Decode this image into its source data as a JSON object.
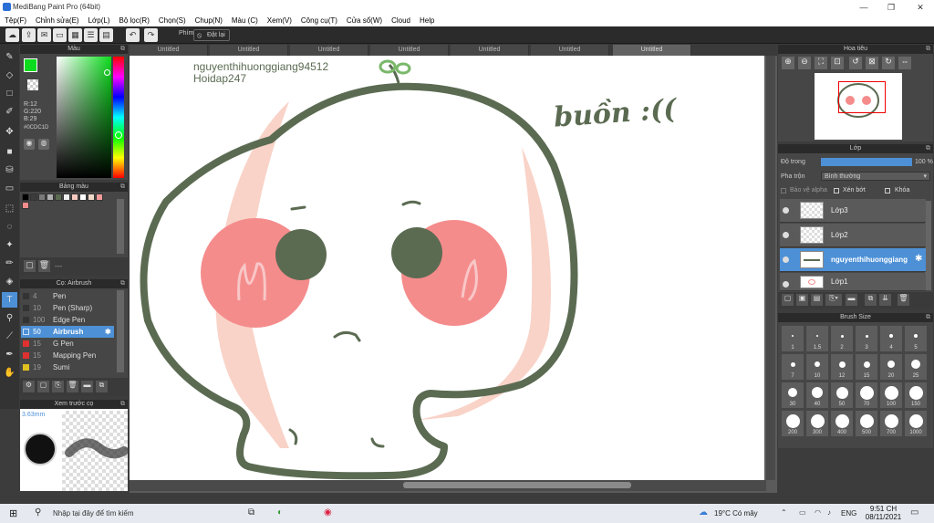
{
  "app": {
    "title": "MediBang Paint Pro (64bit)"
  },
  "menu": [
    "Tệp(F)",
    "Chỉnh sửa(E)",
    "Lớp(L)",
    "Bộ lọc(R)",
    "Chọn(S)",
    "Chụp(N)",
    "Màu (C)",
    "Xem(V)",
    "Công cụ(T)",
    "Cửa sổ(W)",
    "Cloud",
    "Help"
  ],
  "toolbar": {
    "keys_label": "Phím",
    "reset_label": "Đặt lại"
  },
  "tabs": [
    "Untitled",
    "Untitled",
    "Untitled",
    "Untitled",
    "Untitled",
    "Untitled",
    "Untitled"
  ],
  "color_panel": {
    "title": "Màu",
    "r": "R:12",
    "g": "G:220",
    "b": "B:29",
    "hex": "#0CDC1D",
    "fg_color": "#0CDC1D"
  },
  "palette_panel": {
    "title": "Bảng màu",
    "footer": "---",
    "swatches": [
      "#000000",
      "#3c3c3c",
      "#7a7a7a",
      "#b0b0b0",
      "#5b6b52",
      "#f0f0f0",
      "#f4c9c0",
      "#ffffff",
      "#efd8c8",
      "#f39a9a",
      "#f58c8c"
    ]
  },
  "brush_panel": {
    "title": "Cọ: Airbrush",
    "items": [
      {
        "size": "4",
        "name": "Pen",
        "color": "#333333"
      },
      {
        "size": "10",
        "name": "Pen (Sharp)",
        "color": "#333333"
      },
      {
        "size": "100",
        "name": "Edge Pen",
        "color": "#333333"
      },
      {
        "size": "50",
        "name": "Airbrush",
        "color": "#4d90d6",
        "selected": true
      },
      {
        "size": "15",
        "name": "G Pen",
        "color": "#e03030"
      },
      {
        "size": "15",
        "name": "Mapping Pen",
        "color": "#e03030"
      },
      {
        "size": "19",
        "name": "Sumi",
        "color": "#e0c020"
      }
    ]
  },
  "preview_panel": {
    "title": "Xem trước cọ",
    "size": "3.63mm"
  },
  "canvas": {
    "text_username": "nguyenthihuonggiang94512",
    "text_site": "Hoidap247",
    "text_sad": "buồn :(("
  },
  "navigator": {
    "title": "Hoa tiêu"
  },
  "layer_panel": {
    "title": "Lớp",
    "opacity_label": "Độ trong",
    "opacity_value": "100 %",
    "opacity_fraction": 1.0,
    "blend_label": "Pha trộn",
    "blend_value": "Bình thường",
    "protect_alpha": "Bảo vệ alpha",
    "clip": "Xén bớt",
    "lock": "Khóa",
    "layers": [
      {
        "name": "Lớp3",
        "selected": false
      },
      {
        "name": "Lớp2",
        "selected": false
      },
      {
        "name": "nguyenthihuonggiang",
        "selected": true
      },
      {
        "name": "Lớp1",
        "selected": false
      }
    ]
  },
  "brush_size_panel": {
    "title": "Brush Size",
    "sizes": [
      "1",
      "1.5",
      "2",
      "3",
      "4",
      "5",
      "7",
      "10",
      "12",
      "15",
      "20",
      "25",
      "30",
      "40",
      "50",
      "70",
      "100",
      "150",
      "200",
      "300",
      "400",
      "500",
      "700",
      "1000"
    ]
  },
  "taskbar": {
    "search": "Nhập tại đây để tìm kiếm",
    "weather": "19°C  Có mây",
    "lang": "ENG",
    "time": "9:51 CH",
    "date": "08/11/2021"
  }
}
